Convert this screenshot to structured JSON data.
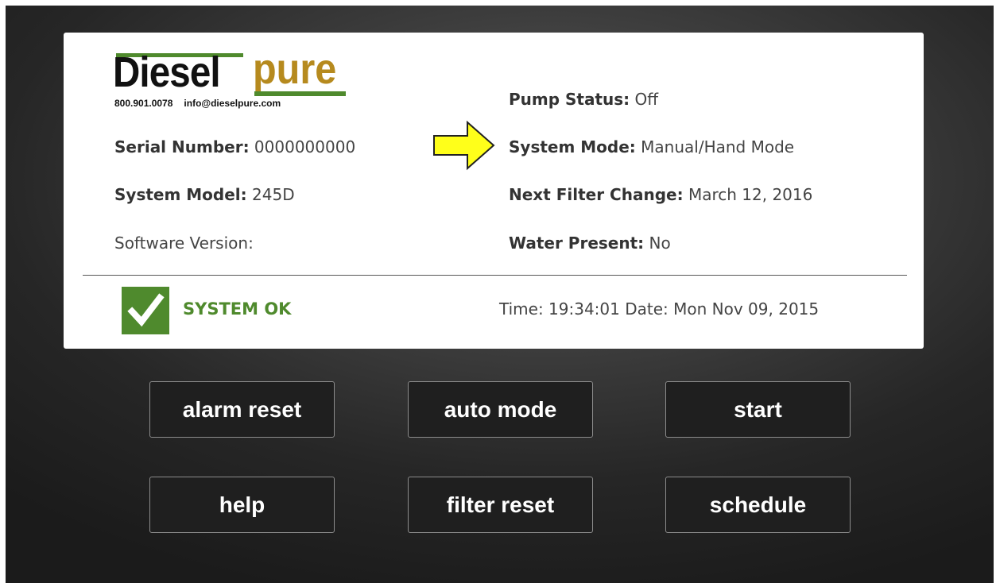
{
  "logo": {
    "brand_part1": "Diesel",
    "brand_part2": "Pure",
    "phone": "800.901.0078",
    "email": "info@dieselpure.com"
  },
  "left_fields": {
    "serial": {
      "label": "Serial Number:",
      "value": "0000000000"
    },
    "model": {
      "label": "System Model:",
      "value": "245D"
    },
    "software": {
      "label": "Software Version:",
      "value": ""
    }
  },
  "right_fields": {
    "pump_status": {
      "label": "Pump Status:",
      "value": "Off"
    },
    "system_mode": {
      "label": "System Mode:",
      "value": "Manual/Hand Mode"
    },
    "next_filter": {
      "label": "Next Filter Change:",
      "value": "March 12, 2016"
    },
    "water_present": {
      "label": "Water Present:",
      "value": "No"
    }
  },
  "status": {
    "text": "SYSTEM OK",
    "color": "#4f8a2d"
  },
  "datetime": {
    "time_label": "Time:",
    "time": "19:34:01",
    "date_label": "Date:",
    "date": "Mon Nov 09, 2015"
  },
  "buttons": {
    "alarm_reset": "alarm reset",
    "auto_mode": "auto mode",
    "start": "start",
    "help": "help",
    "filter_reset": "filter reset",
    "schedule": "schedule"
  },
  "colors": {
    "arrow": "#ffff1a",
    "brand_green": "#4f8a2d",
    "brand_gold": "#b68a1e"
  }
}
